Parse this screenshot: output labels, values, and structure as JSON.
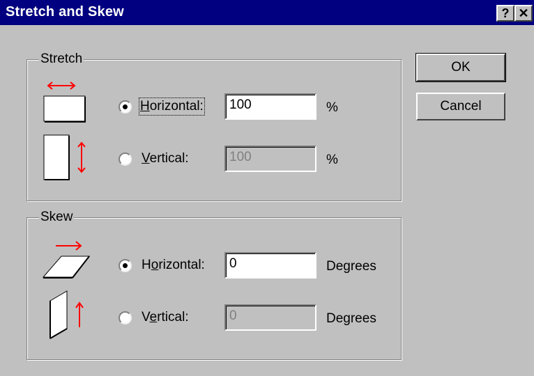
{
  "window": {
    "title": "Stretch and Skew",
    "help_label": "?",
    "close_label": "✕"
  },
  "stretch": {
    "group_label": "Stretch",
    "horizontal": {
      "pre": "",
      "mnemonic": "H",
      "post": "orizontal:",
      "value": "100",
      "unit": "%",
      "selected": true
    },
    "vertical": {
      "pre": "",
      "mnemonic": "V",
      "post": "ertical:",
      "value": "100",
      "unit": "%",
      "selected": false
    }
  },
  "skew": {
    "group_label": "Skew",
    "horizontal": {
      "pre": "H",
      "mnemonic": "o",
      "post": "rizontal:",
      "value": "0",
      "unit": "Degrees",
      "selected": true
    },
    "vertical": {
      "pre": "V",
      "mnemonic": "e",
      "post": "rtical:",
      "value": "0",
      "unit": "Degrees",
      "selected": false
    }
  },
  "buttons": {
    "ok": "OK",
    "cancel": "Cancel"
  },
  "colors": {
    "titlebar": "#000080",
    "face": "#c0c0c0",
    "arrow": "#ff0000"
  },
  "icons": {
    "stretch_horizontal": "stretch-horizontal-icon",
    "stretch_vertical": "stretch-vertical-icon",
    "skew_horizontal": "skew-horizontal-icon",
    "skew_vertical": "skew-vertical-icon"
  }
}
